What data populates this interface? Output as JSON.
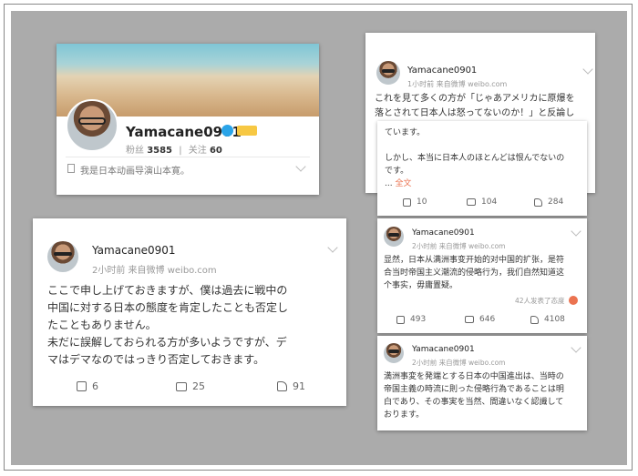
{
  "profile": {
    "name": "Yamacane0901",
    "followers_label": "粉丝",
    "followers": "3585",
    "divider": "|",
    "following_label": "关注",
    "following": "60",
    "bio": "我是日本动画导演山本寛。"
  },
  "post_large": {
    "name": "Yamacane0901",
    "meta": "2小时前  来自微博 weibo.com",
    "lines": [
      "ここで申し上げておきますが、僕は過去に戦中の",
      "中国に対する日本の態度を肯定したことも否定し",
      "たこともありません。",
      "未だに誤解しておられる方が多いようですが、デ",
      "マはデマなのではっきり否定しておきます。"
    ],
    "shares": "6",
    "comments": "25",
    "likes": "91"
  },
  "post_top_right": {
    "name": "Yamacane0901",
    "meta": "1小时前  来自微博 weibo.com",
    "lines": [
      "これを見て多くの方が「じゃあアメリカに原爆を",
      "落とされて日本人は怒ってないのか！」と反論し"
    ]
  },
  "post_continued": {
    "lines": [
      "ています。",
      "",
      "しかし、本当に日本人のほとんどは恨んでないの",
      "です。"
    ],
    "more_prefix": "... ",
    "more_link": "全文",
    "shares": "10",
    "comments": "104",
    "likes": "284"
  },
  "post_mid_right": {
    "name": "Yamacane0901",
    "meta": "2小时前  来自微博 weibo.com",
    "lines": [
      "显然，日本从满洲事变开始的对中国的扩张，是符",
      "合当时帝国主义潮流的侵略行为，我们自然知道这",
      "个事实，毋庸置疑。"
    ],
    "reactions": "42人发表了态度",
    "shares": "493",
    "comments": "646",
    "likes": "4108"
  },
  "post_bottom_right": {
    "name": "Yamacane0901",
    "meta": "2小时前  来自微博 weibo.com",
    "lines": [
      "満洲事変を発端とする日本の中国進出は、当時の",
      "帝国主義の時流に則った侵略行為であることは明",
      "白であり、その事実を当然、間違いなく認識して",
      "おります。"
    ]
  },
  "colors": {
    "link": "#eb7350",
    "verified": "#2aa4e8",
    "badge": "#f7c843"
  },
  "icons": [
    "share-icon",
    "comment-icon",
    "like-icon",
    "chevron-down-icon",
    "verified-icon",
    "bio-icon"
  ]
}
